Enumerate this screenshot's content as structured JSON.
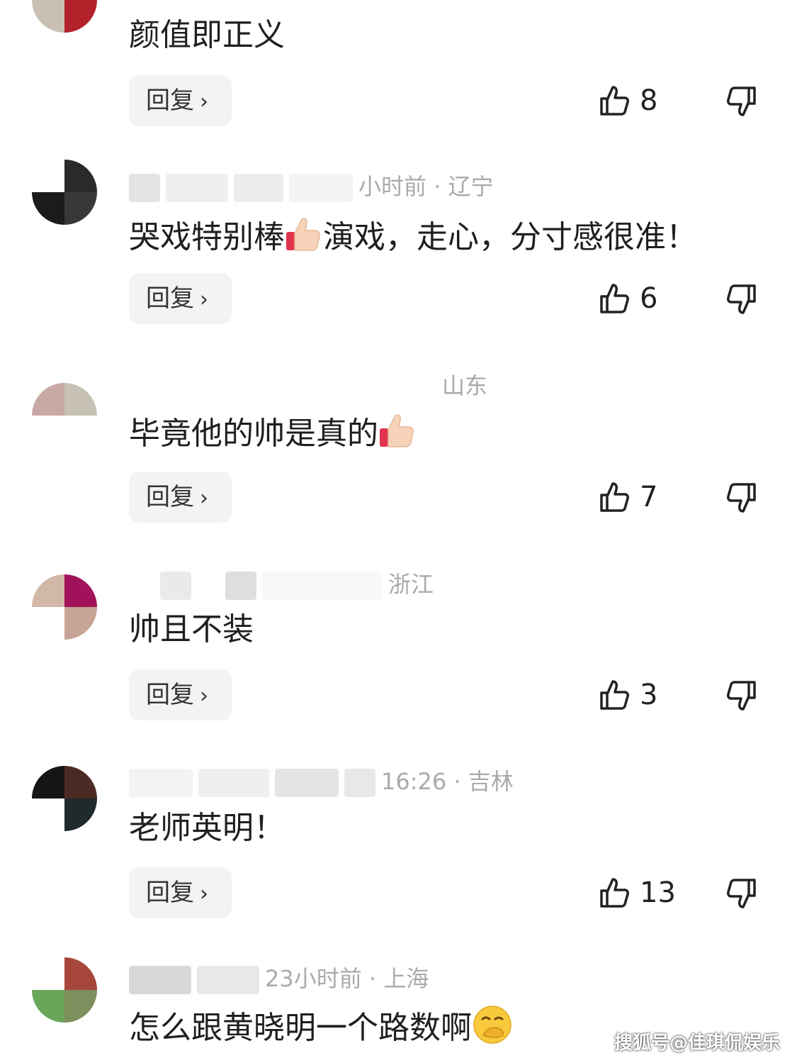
{
  "comments": [
    {
      "location": "",
      "text": "颜值即正义",
      "reply_label": "回复",
      "likes": "8"
    },
    {
      "location": "小时前 · 辽宁",
      "text": "哭戏特别棒",
      "text2": "演戏，走心，分寸感很准！",
      "reply_label": "回复",
      "likes": "6"
    },
    {
      "location": "山东",
      "text": "毕竟他的帅是真的",
      "reply_label": "回复",
      "likes": "7"
    },
    {
      "location": "浙江",
      "text": "帅且不装",
      "reply_label": "回复",
      "likes": "3"
    },
    {
      "location": "16:26 · 吉林",
      "text": "老师英明！",
      "reply_label": "回复",
      "likes": "13"
    },
    {
      "location": "23小时前 · 上海",
      "text": "怎么跟黄晓明一个路数啊",
      "reply_label": "回复",
      "likes": ""
    }
  ],
  "icons": {
    "like": "thumbs-up-icon",
    "dislike": "thumbs-down-icon",
    "reply_chevron": "chevron-right-icon"
  },
  "watermark": "搜狐号@佳琪侃娱乐",
  "colors": {
    "reply_bg": "#f3f3f3",
    "meta_text": "#aaaaaa",
    "body_text": "#1f1f1f"
  }
}
